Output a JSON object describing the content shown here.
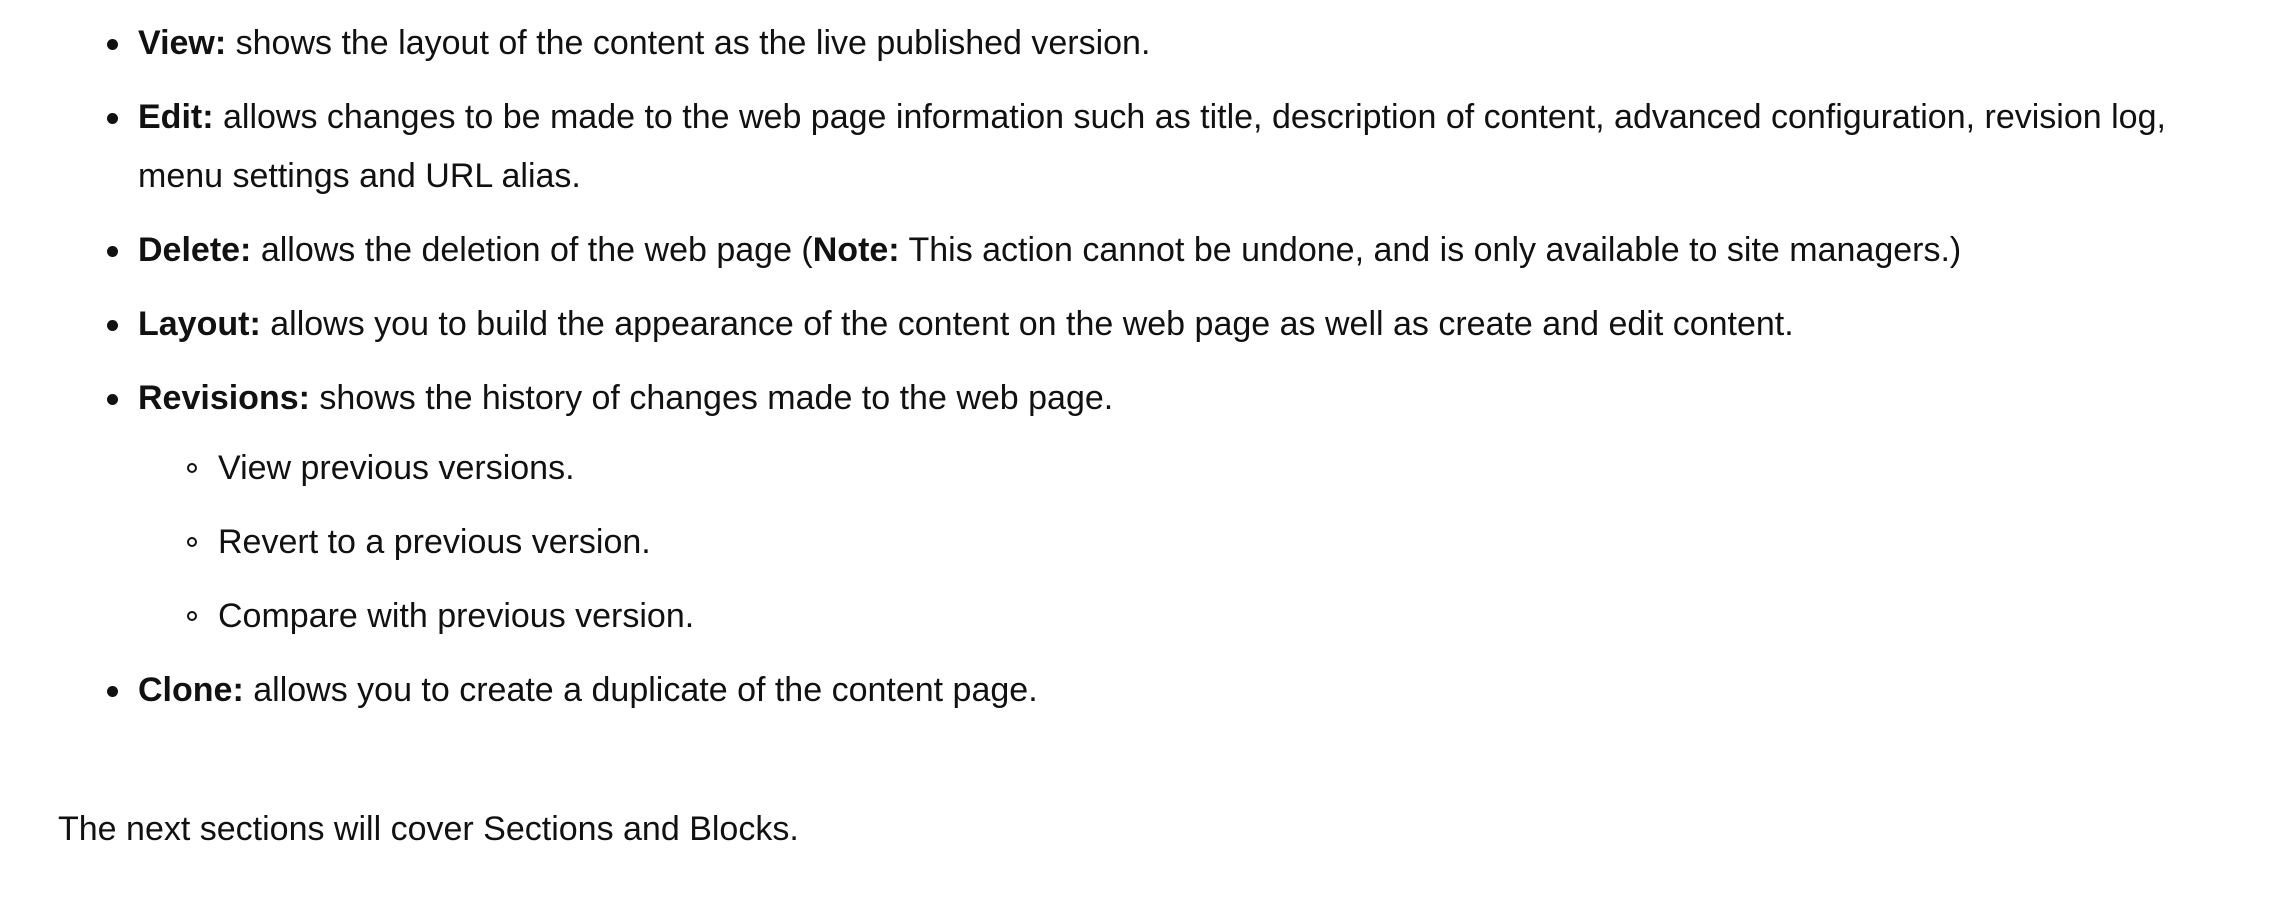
{
  "items": [
    {
      "term": "View:",
      "text": " shows the layout of the content as the live published version."
    },
    {
      "term": "Edit:",
      "text": " allows changes to be made to the web page information such as title, description of content, advanced configuration, revision log, menu settings and URL alias."
    },
    {
      "term": "Delete:",
      "text": " allows the deletion of the web page (",
      "note_term": "Note:",
      "note_text": " This action cannot be undone, and is only available to site managers.)"
    },
    {
      "term": "Layout:",
      "text": " allows you to build the appearance of the content on the web page as well as create and edit content."
    },
    {
      "term": "Revisions:",
      "text": " shows the history of changes made to the web page.",
      "subitems": [
        "View previous versions.",
        "Revert to a previous version.",
        "Compare with previous version."
      ]
    },
    {
      "term": "Clone:",
      "text": " allows you to create a duplicate of the content page."
    }
  ],
  "closing": "The next sections will cover Sections and Blocks."
}
